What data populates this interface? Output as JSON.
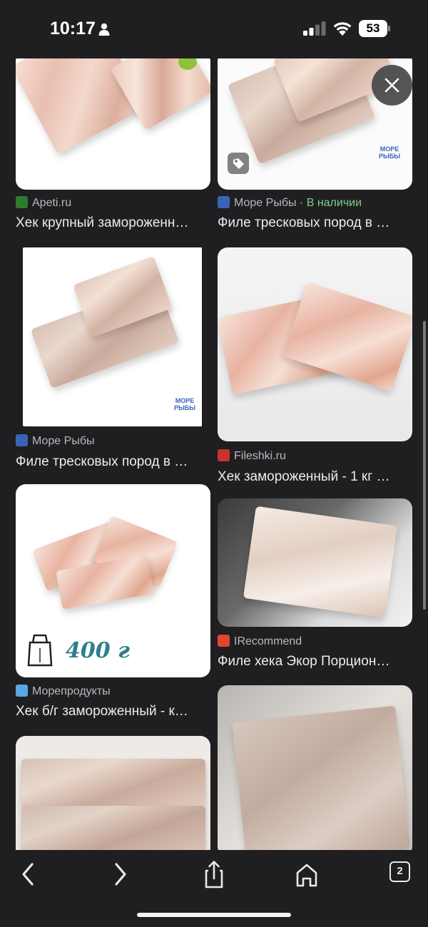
{
  "status_bar": {
    "time": "10:17",
    "battery": "53"
  },
  "results": [
    {
      "source": "Apeti.ru",
      "favicon_color": "#2f7a2f",
      "caption": "Хек крупный замороженн…"
    },
    {
      "source": "Море Рыбы",
      "stock": "В наличии",
      "favicon_color": "#3a63b8",
      "caption": "Филе тресковых пород в …",
      "logo_lines": [
        "МОРЕ",
        "РЫБЫ"
      ]
    },
    {
      "source": "Море Рыбы",
      "favicon_color": "#3a63b8",
      "caption": "Филе тресковых пород в …",
      "logo_lines": [
        "МОРЕ",
        "РЫБЫ"
      ]
    },
    {
      "source": "Fileshki.ru",
      "favicon_color": "#c8332c",
      "caption": "Хек замороженный - 1 кг …"
    },
    {
      "source": "Морепродукты",
      "favicon_color": "#5aa7e0",
      "caption": "Хек б/г замороженный - к…",
      "weight": "400 г"
    },
    {
      "source": "IRecommend",
      "favicon_color": "#e0462f",
      "caption": "Филе хека Экор Порцион…"
    }
  ],
  "stock_separator": " · ",
  "icons": {
    "close": "close-icon",
    "back": "chevron-left-icon",
    "forward": "chevron-right-icon",
    "share": "share-icon",
    "home": "home-icon",
    "tabs": "tabs-icon"
  },
  "toolbar": {
    "tab_count": "2"
  }
}
